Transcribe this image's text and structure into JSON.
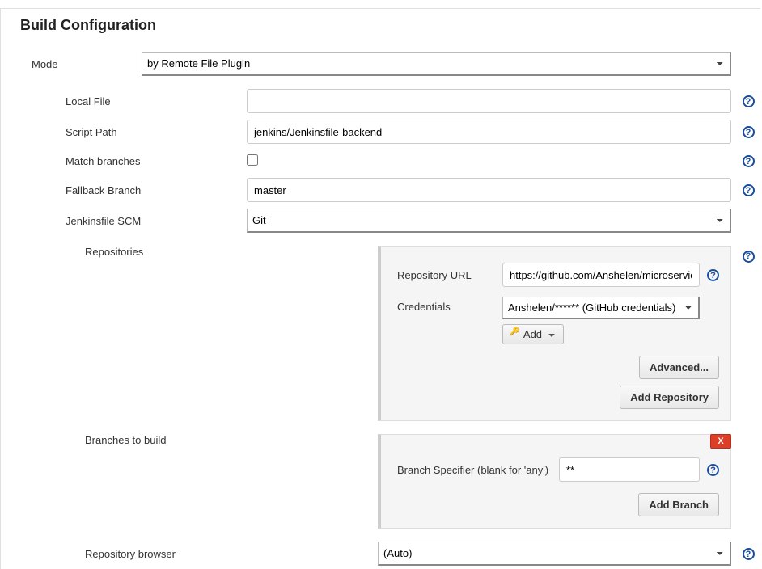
{
  "section_title": "Build Configuration",
  "mode": {
    "label": "Mode",
    "value": "by Remote File Plugin"
  },
  "local_file": {
    "label": "Local File",
    "value": ""
  },
  "script_path": {
    "label": "Script Path",
    "value": "jenkins/Jenkinsfile-backend"
  },
  "match_branches": {
    "label": "Match branches",
    "checked": false
  },
  "fallback_branch": {
    "label": "Fallback Branch",
    "value": "master"
  },
  "jenkinsfile_scm": {
    "label": "Jenkinsfile SCM",
    "value": "Git"
  },
  "repositories": {
    "label": "Repositories",
    "repo_url": {
      "label": "Repository URL",
      "value": "https://github.com/Anshelen/microservices-deploy"
    },
    "credentials": {
      "label": "Credentials",
      "value": "Anshelen/****** (GitHub credentials)",
      "add_btn": "Add"
    },
    "advanced_btn": "Advanced...",
    "add_repo_btn": "Add Repository"
  },
  "branches": {
    "label": "Branches to build",
    "specifier": {
      "label": "Branch Specifier (blank for 'any')",
      "value": "**"
    },
    "add_branch_btn": "Add Branch",
    "delete_btn": "X"
  },
  "repo_browser": {
    "label": "Repository browser",
    "value": "(Auto)"
  },
  "help_glyph": "?"
}
